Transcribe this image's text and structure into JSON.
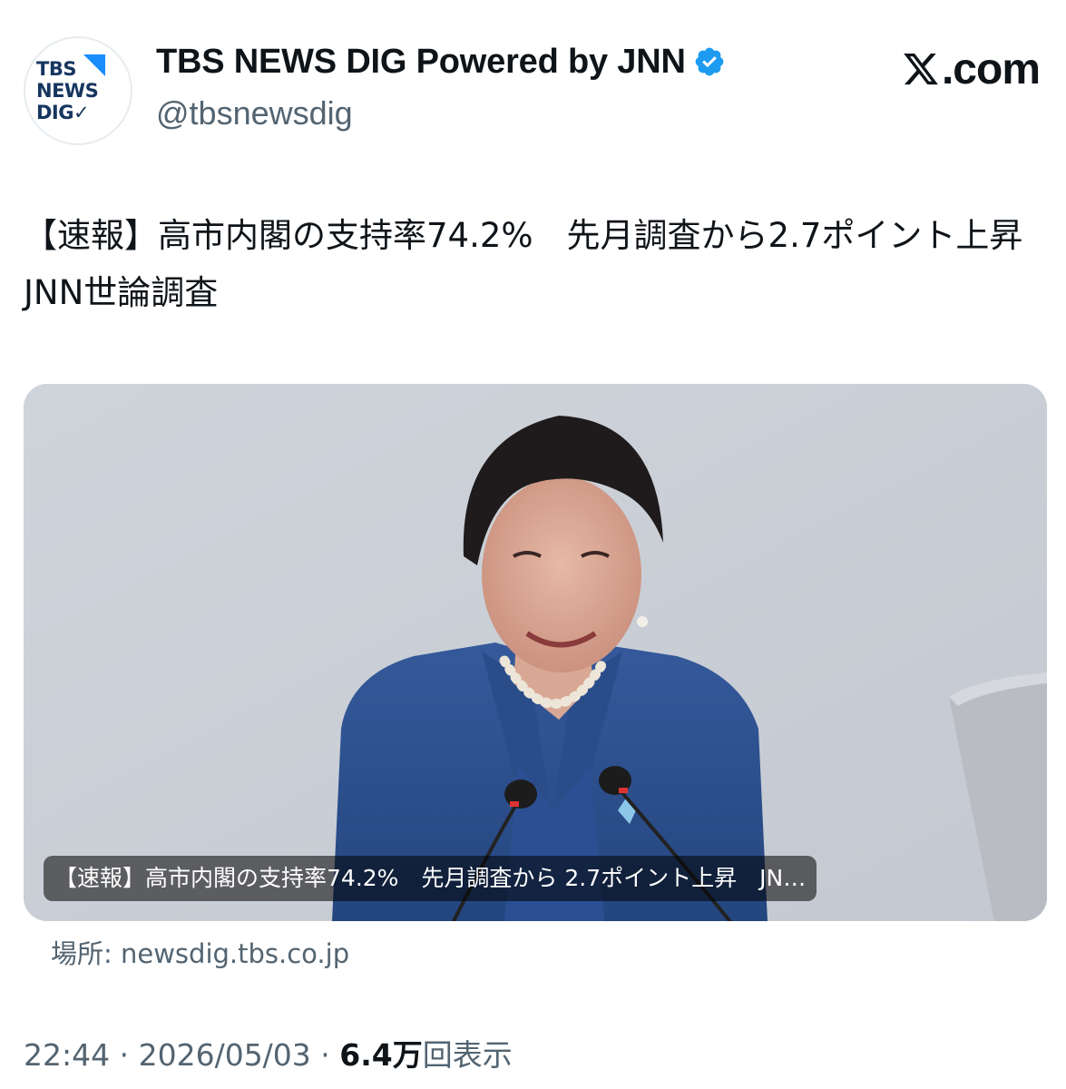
{
  "account": {
    "display_name": "TBS NEWS DIG Powered by JNN",
    "handle": "@tbsnewsdig",
    "avatar_logo_lines": [
      "TBS",
      "NEWS",
      "DIG✓"
    ],
    "verified_color": "#1d9bf0"
  },
  "brand": {
    "site": ".com",
    "x_glyph": "X"
  },
  "tweet": {
    "text": "【速報】高市内閣の支持率74.2%　先月調査から2.7ポイント上昇　JNN世論調査"
  },
  "card": {
    "caption": "【速報】高市内閣の支持率74.2%　先月調査から 2.7ポイント上昇　JN…",
    "source": "場所: newsdig.tbs.co.jp"
  },
  "meta": {
    "time": "22:44",
    "separator": " · ",
    "date": "2026/05/03",
    "views_number": "6.4万",
    "views_label": "回表示"
  },
  "colors": {
    "text_primary": "#0f1419",
    "text_secondary": "#536471",
    "verified": "#1d9bf0",
    "logo_navy": "#16355f",
    "logo_blue": "#1a8dff",
    "jacket_blue": "#2d4f8c",
    "background_wall": "#ccd1d8"
  }
}
